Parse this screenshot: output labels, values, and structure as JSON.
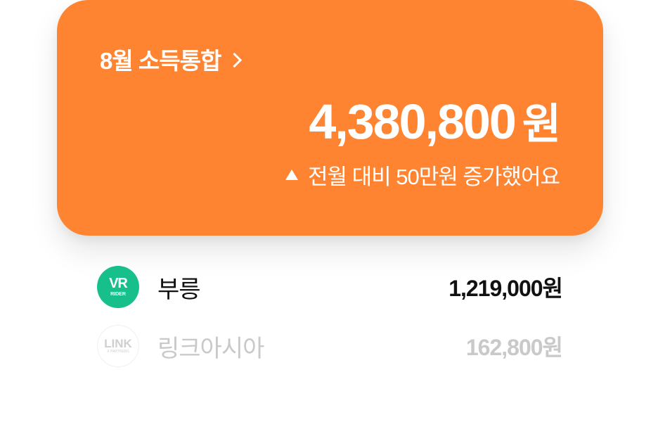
{
  "card": {
    "title": "8월 소득통합",
    "amount": "4,380,800",
    "unit": "원",
    "change_text": "전월 대비 50만원 증가했어요",
    "background_color": "#ff8432"
  },
  "income_sources": [
    {
      "name": "부릉",
      "amount": "1,219,000원",
      "logo_text": "VR",
      "logo_subtext": "RIDER",
      "logo_color": "#17c08b",
      "state": "active"
    },
    {
      "name": "링크아시아",
      "amount": "162,800원",
      "logo_text": "LINK",
      "logo_subtext": "X PARTNERS",
      "logo_color": "#cfcfcf",
      "state": "inactive"
    }
  ]
}
